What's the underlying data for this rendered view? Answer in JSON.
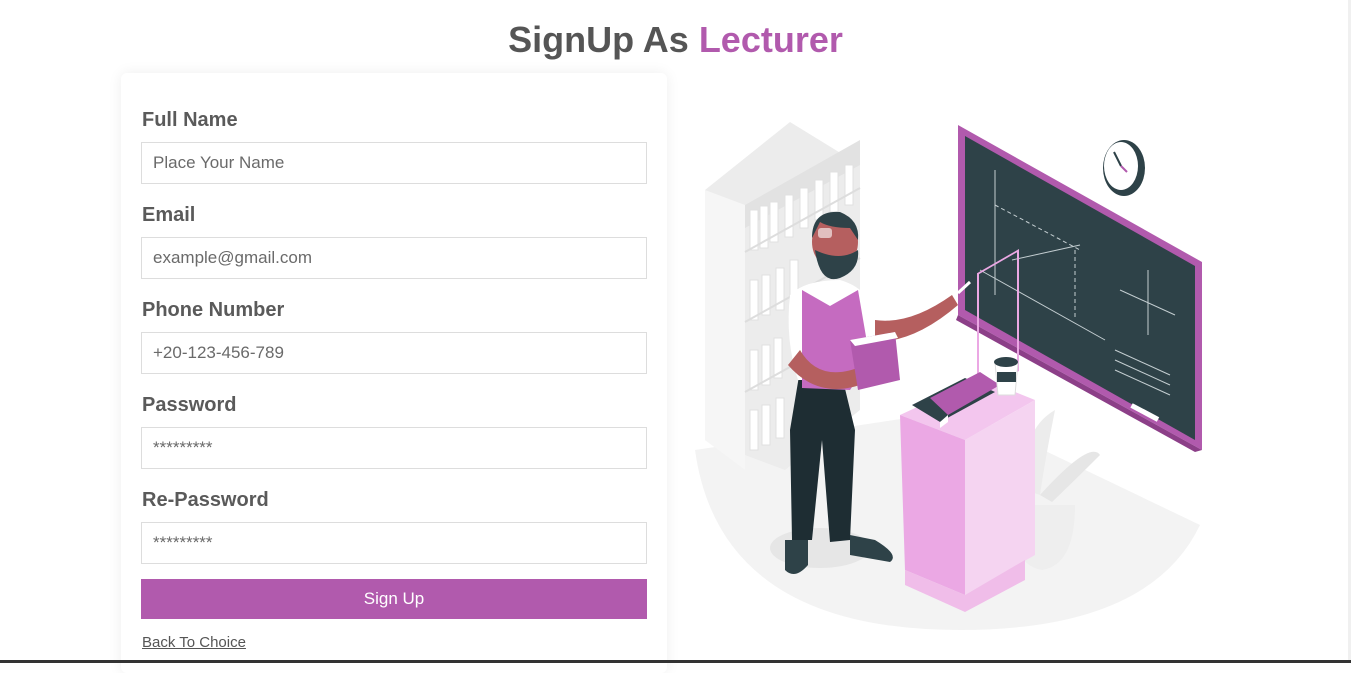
{
  "header": {
    "title_prefix": "SignUp As",
    "title_accent": "Lecturer"
  },
  "form": {
    "full_name": {
      "label": "Full Name",
      "placeholder": "Place Your Name"
    },
    "email": {
      "label": "Email",
      "placeholder": "example@gmail.com"
    },
    "phone": {
      "label": "Phone Number",
      "placeholder": "+20-123-456-789"
    },
    "password": {
      "label": "Password",
      "placeholder": "*********"
    },
    "re_password": {
      "label": "Re-Password",
      "placeholder": "*********"
    },
    "submit_label": "Sign Up",
    "back_link": "Back To Choice"
  },
  "colors": {
    "accent": "#b15aad",
    "text": "#555555",
    "chalkboard": "#2e4248"
  },
  "illustration": {
    "icon": "lecturer-at-chalkboard-illustration"
  }
}
